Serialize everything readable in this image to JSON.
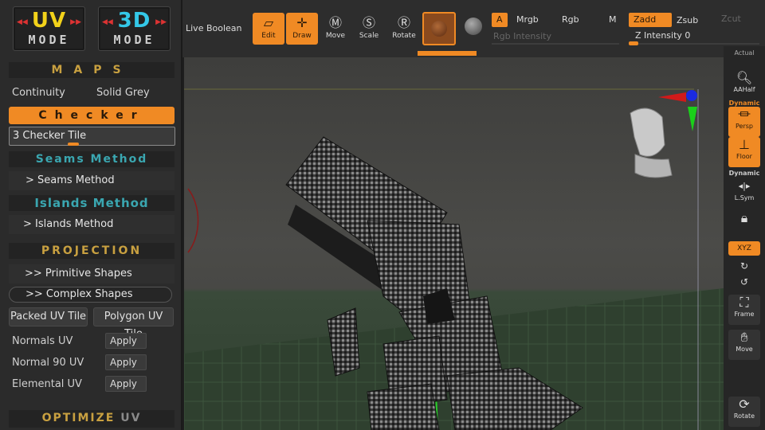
{
  "colors": {
    "accent": "#f08a24",
    "uv_yellow": "#f2d21a",
    "threed_cyan": "#34c8e8",
    "teal": "#3aa6b0",
    "gold": "#c8a040"
  },
  "modes": {
    "uv": {
      "big": "UV",
      "small": "MODE"
    },
    "threed": {
      "big": "3D",
      "small": "MODE"
    }
  },
  "maps": {
    "header": "MAPS",
    "continuity": "Continuity",
    "solid_grey": "Solid Grey",
    "checker_button": "Checker",
    "slider_label": "3 Checker Tile"
  },
  "seams": {
    "header": "Seams Method",
    "item": "> Seams Method"
  },
  "islands": {
    "header": "Islands Method",
    "item": "> Islands Method"
  },
  "projection": {
    "header": "PROJECTION",
    "primitive": ">> Primitive Shapes",
    "complex": ">> Complex Shapes",
    "packed": "Packed UV Tile",
    "polygon": "Polygon UV Tile"
  },
  "uv_rows": [
    {
      "label": "Normals UV",
      "button": "Apply"
    },
    {
      "label": "Normal 90 UV",
      "button": "Apply"
    },
    {
      "label": "Elemental UV",
      "button": "Apply"
    }
  ],
  "optimize": {
    "header_a": "OPTIMIZE",
    "header_b": "UV"
  },
  "topbar": {
    "live_boolean": "Live Boolean",
    "edit": "Edit",
    "draw": "Draw",
    "move": "Move",
    "scale": "Scale",
    "rotate": "Rotate",
    "a": "A",
    "mrgb": "Mrgb",
    "rgb": "Rgb",
    "m": "M",
    "zadd": "Zadd",
    "zsub": "Zsub",
    "zcut": "Zcut",
    "rgb_intensity": "Rgb Intensity",
    "z_intensity": "Z Intensity 0"
  },
  "rightbar": {
    "actual": "Actual",
    "aahalf": "AAHalf",
    "dynamic1": "Dynamic",
    "persp": "Persp",
    "floor": "Floor",
    "dynamic2": "Dynamic",
    "lsym": "L.Sym",
    "xyz": "XYZ",
    "frame": "Frame",
    "move": "Move",
    "rotate": "Rotate"
  }
}
